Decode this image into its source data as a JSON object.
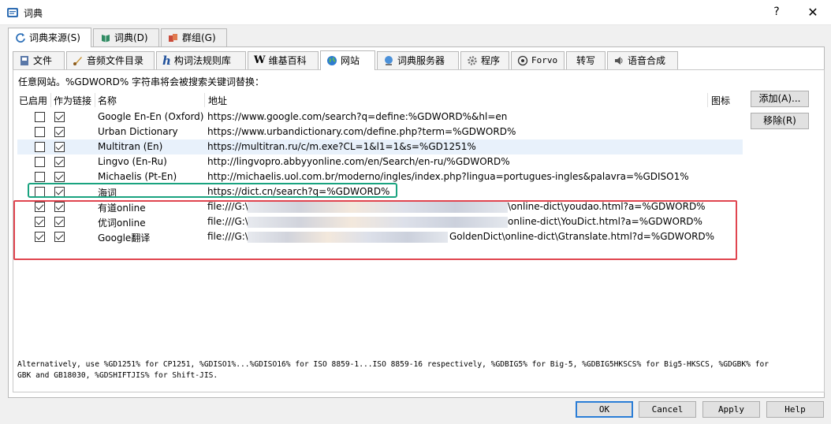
{
  "window": {
    "title": "词典",
    "help_label": "?",
    "close_label": "✕"
  },
  "top_tabs": [
    {
      "label": "词典来源(S)",
      "icon": "refresh-icon"
    },
    {
      "label": "词典(D)",
      "icon": "book-icon"
    },
    {
      "label": "群组(G)",
      "icon": "group-icon"
    }
  ],
  "sub_tabs": [
    {
      "label": "文件",
      "icon": "file-icon"
    },
    {
      "label": "音频文件目录",
      "icon": "audio-folder-icon"
    },
    {
      "label": "构词法规则库",
      "icon": "h-icon"
    },
    {
      "label": "维基百科",
      "icon": "wikipedia-icon"
    },
    {
      "label": "网站",
      "icon": "globe-icon"
    },
    {
      "label": "词典服务器",
      "icon": "server-icon"
    },
    {
      "label": "程序",
      "icon": "gear-icon"
    },
    {
      "label": "Forvo",
      "icon": "forvo-icon"
    },
    {
      "label": "转写",
      "icon": ""
    },
    {
      "label": "语音合成",
      "icon": "speaker-icon"
    }
  ],
  "hint": "任意网站。%GDWORD% 字符串将会被搜索关键词替换：",
  "columns": {
    "enabled": "已启用",
    "as_link": "作为链接",
    "name": "名称",
    "address": "地址",
    "icon": "图标"
  },
  "rows": [
    {
      "enabled": false,
      "as_link": true,
      "name": "Google En-En (Oxford)",
      "url": "https://www.google.com/search?q=define:%GDWORD%&hl=en"
    },
    {
      "enabled": false,
      "as_link": true,
      "name": "Urban Dictionary",
      "url": "https://www.urbandictionary.com/define.php?term=%GDWORD%"
    },
    {
      "enabled": false,
      "as_link": true,
      "name": "Multitran (En)",
      "url": "https://multitran.ru/c/m.exe?CL=1&l1=1&s=%GD1251%"
    },
    {
      "enabled": false,
      "as_link": true,
      "name": "Lingvo (En-Ru)",
      "url": "http://lingvopro.abbyyonline.com/en/Search/en-ru/%GDWORD%"
    },
    {
      "enabled": false,
      "as_link": true,
      "name": "Michaelis (Pt-En)",
      "url": "http://michaelis.uol.com.br/moderno/ingles/index.php?lingua=portugues-ingles&palavra=%GDISO1%"
    },
    {
      "enabled": false,
      "as_link": true,
      "name": "海词",
      "url": "https://dict.cn/search?q=%GDWORD%"
    },
    {
      "enabled": true,
      "as_link": true,
      "name": "有道online",
      "url_start": "file:///G:\\",
      "url_end": "\\online-dict\\youdao.html?a=%GDWORD%"
    },
    {
      "enabled": true,
      "as_link": true,
      "name": "优词online",
      "url_start": "file:///G:\\",
      "url_end": "online-dict\\YouDict.html?a=%GDWORD%"
    },
    {
      "enabled": true,
      "as_link": true,
      "name": "Google翻译",
      "url_start": "file:///G:\\",
      "url_end": "GoldenDict\\online-dict\\Gtranslate.html?d=%GDWORD%"
    }
  ],
  "buttons": {
    "add": "添加(A)...",
    "remove": "移除(R)"
  },
  "note_line1": "Alternatively, use %GD1251% for CP1251, %GDISO1%...%GDISO16% for ISO 8859-1...ISO 8859-16 respectively, %GDBIG5% for Big-5, %GDBIG5HKSCS% for Big5-HKSCS, %GDGBK% for",
  "note_line2": "GBK and GB18030, %GDSHIFTJIS% for Shift-JIS.",
  "dialog_buttons": {
    "ok": "OK",
    "cancel": "Cancel",
    "apply": "Apply",
    "help": "Help"
  },
  "colors": {
    "highlight_green": "#19a37f",
    "highlight_red": "#e0454f",
    "selected_row": "#e8f1fb",
    "default_button_border": "#2a7dd6"
  }
}
